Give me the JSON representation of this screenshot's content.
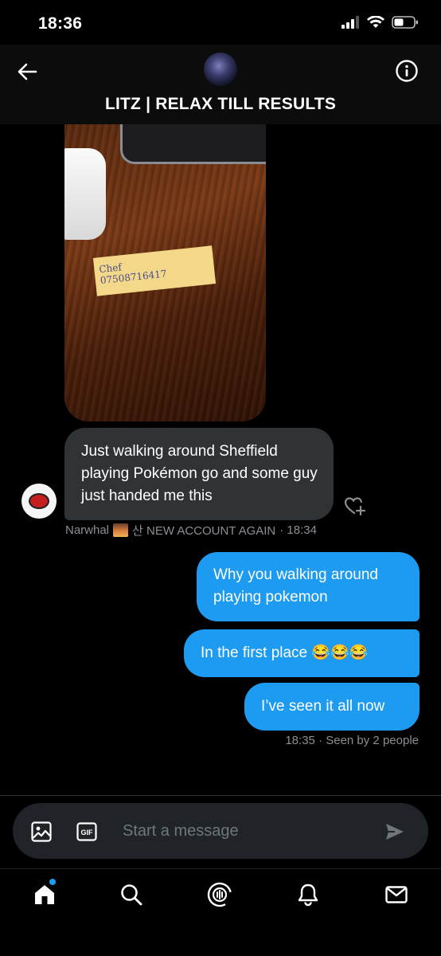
{
  "status_bar": {
    "time": "18:36"
  },
  "header": {
    "title": "LITZ | RELAX TILL RESULTS"
  },
  "photo_note": {
    "text": "Chef\n07508716417"
  },
  "incoming_message": {
    "text": "Just walking around Sheffield playing Pokémon go and some guy just handed me this",
    "sender_name": "Narwhal",
    "sender_suffix": "산 NEW ACCOUNT AGAIN",
    "time": "· 18:34"
  },
  "outgoing_messages": [
    {
      "text": "Why you walking around\nplaying pokemon"
    },
    {
      "text": "In the first place 😂😂😂"
    },
    {
      "text": "I’ve seen it all now"
    }
  ],
  "outgoing_meta": {
    "time": "18:35",
    "seen": "· Seen by 2 people"
  },
  "composer": {
    "placeholder": "Start a message",
    "gif_label": "GIF"
  },
  "colors": {
    "accent": "#1d9bf0",
    "incoming_bubble": "#2f3336",
    "background": "#000000"
  },
  "nav": {
    "items": [
      "home-icon",
      "search-icon",
      "spaces-icon",
      "notifications-icon",
      "messages-icon"
    ]
  }
}
